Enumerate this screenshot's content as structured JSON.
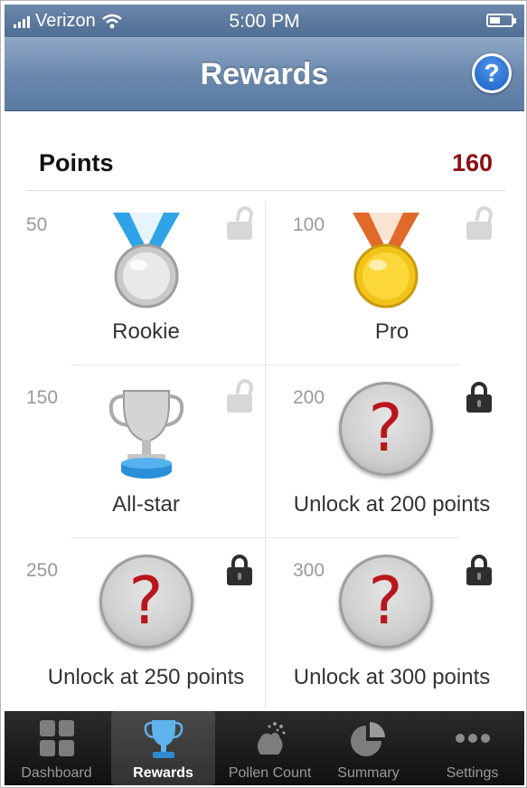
{
  "status_bar": {
    "carrier": "Verizon",
    "time": "5:00 PM"
  },
  "navbar": {
    "title": "Rewards",
    "help_label": "?"
  },
  "points": {
    "label": "Points",
    "value": "160"
  },
  "rewards": [
    {
      "points": "50",
      "label": "Rookie",
      "state": "unlocked",
      "badge": "silver-medal-icon"
    },
    {
      "points": "100",
      "label": "Pro",
      "state": "unlocked",
      "badge": "gold-medal-icon"
    },
    {
      "points": "150",
      "label": "All-star",
      "state": "unlocked",
      "badge": "trophy-icon"
    },
    {
      "points": "200",
      "label": "Unlock at 200 points",
      "state": "locked",
      "badge": "question-mark-icon"
    },
    {
      "points": "250",
      "label": "Unlock at 250 points",
      "state": "locked",
      "badge": "question-mark-icon"
    },
    {
      "points": "300",
      "label": "Unlock at 300 points",
      "state": "locked",
      "badge": "question-mark-icon"
    }
  ],
  "question_glyph": "?",
  "tabs": [
    {
      "label": "Dashboard",
      "icon": "dashboard-grid-icon",
      "active": false
    },
    {
      "label": "Rewards",
      "icon": "trophy-icon",
      "active": true
    },
    {
      "label": "Pollen Count",
      "icon": "pollen-icon",
      "active": false
    },
    {
      "label": "Summary",
      "icon": "pie-chart-icon",
      "active": false
    },
    {
      "label": "Settings",
      "icon": "more-dots-icon",
      "active": false
    }
  ],
  "colors": {
    "navbar": "#6c89ae",
    "points_value": "#8b0f14",
    "question_mark": "#b8161c",
    "help_button": "#1a5fc3"
  }
}
